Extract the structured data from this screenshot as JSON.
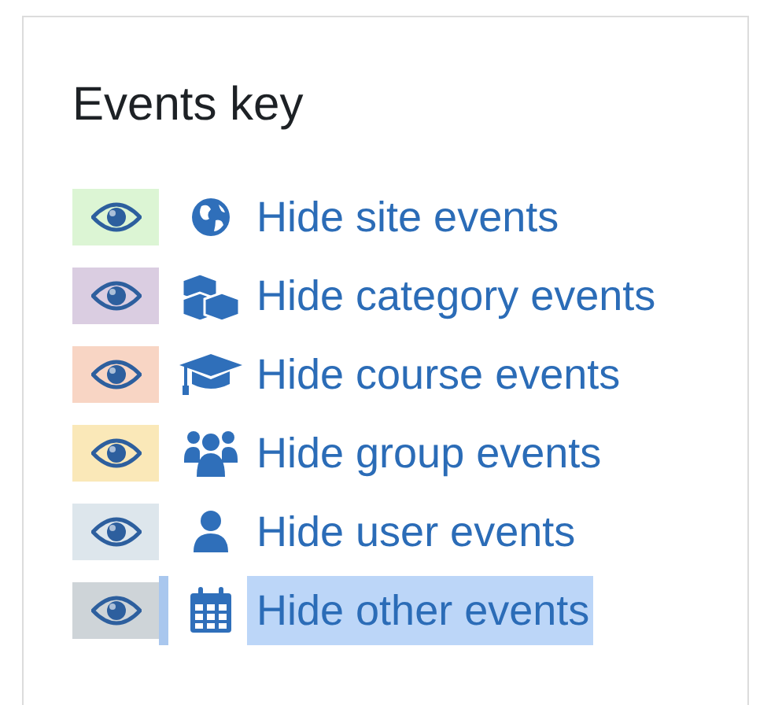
{
  "card": {
    "title": "Events key"
  },
  "items": [
    {
      "label": "Hide site events",
      "kind": "site",
      "color": "#dcf5d4",
      "selected": false
    },
    {
      "label": "Hide category events",
      "kind": "category",
      "color": "#dacde1",
      "selected": false
    },
    {
      "label": "Hide course events",
      "kind": "course",
      "color": "#f8d5c4",
      "selected": false
    },
    {
      "label": "Hide group events",
      "kind": "group",
      "color": "#fae8b8",
      "selected": false
    },
    {
      "label": "Hide user events",
      "kind": "user",
      "color": "#dde6ec",
      "selected": false
    },
    {
      "label": "Hide other events",
      "kind": "other",
      "color": "#ced4d8",
      "selected": true
    }
  ]
}
